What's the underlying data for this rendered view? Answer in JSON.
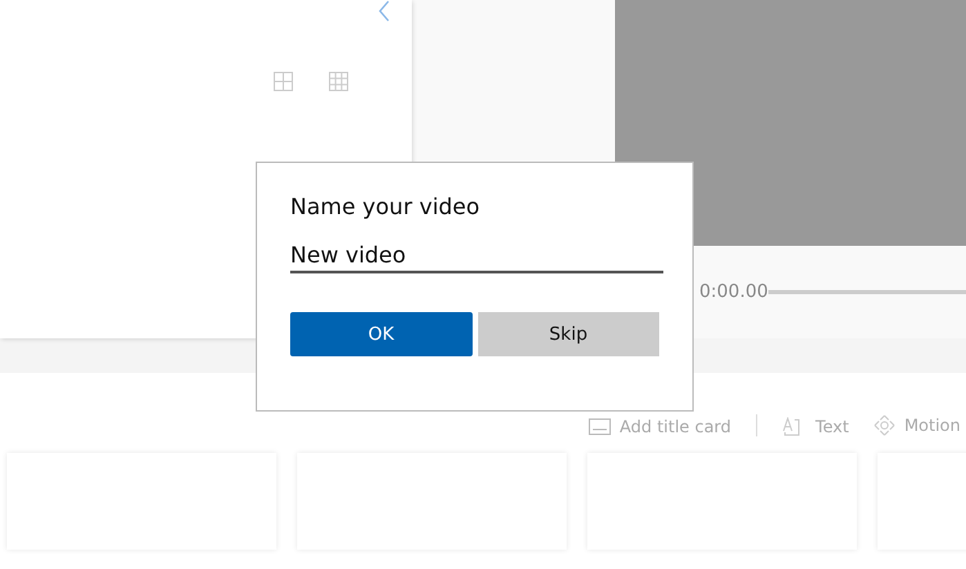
{
  "player": {
    "time": "0:00.00",
    "level": 0
  },
  "toolbar": [
    {
      "kind": "titlecard",
      "label": "Add title card"
    },
    {
      "kind": "text",
      "label": "Text"
    },
    {
      "kind": "motion",
      "label": "Motion"
    }
  ],
  "dialog": {
    "title": "Name your video",
    "value": "New video",
    "buttons": [
      {
        "label": "OK",
        "primary": true
      },
      {
        "label": "Skip",
        "primary": false
      }
    ]
  }
}
